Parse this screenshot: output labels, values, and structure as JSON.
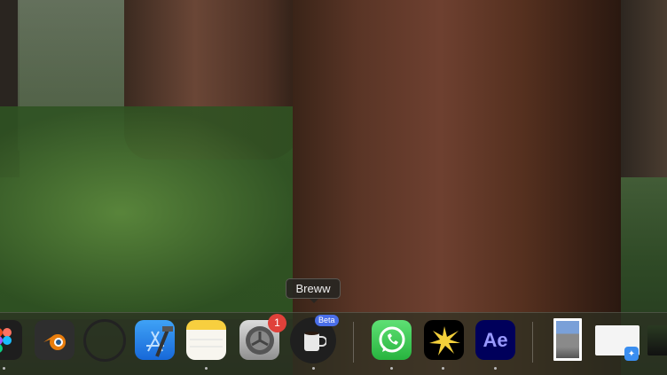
{
  "tooltip": "Breww",
  "dock": {
    "apps": [
      {
        "name": "Figma",
        "running": true
      },
      {
        "name": "Blender",
        "running": false
      },
      {
        "name": "Color app",
        "running": false
      },
      {
        "name": "Xcode",
        "running": false
      },
      {
        "name": "Notes",
        "running": true
      },
      {
        "name": "System Settings",
        "running": false,
        "badge": "1"
      },
      {
        "name": "Breww",
        "running": true,
        "label": "Beta"
      },
      {
        "name": "WhatsApp",
        "running": true
      },
      {
        "name": "Spark",
        "running": true
      },
      {
        "name": "After Effects",
        "running": true,
        "label": "Ae"
      }
    ]
  }
}
